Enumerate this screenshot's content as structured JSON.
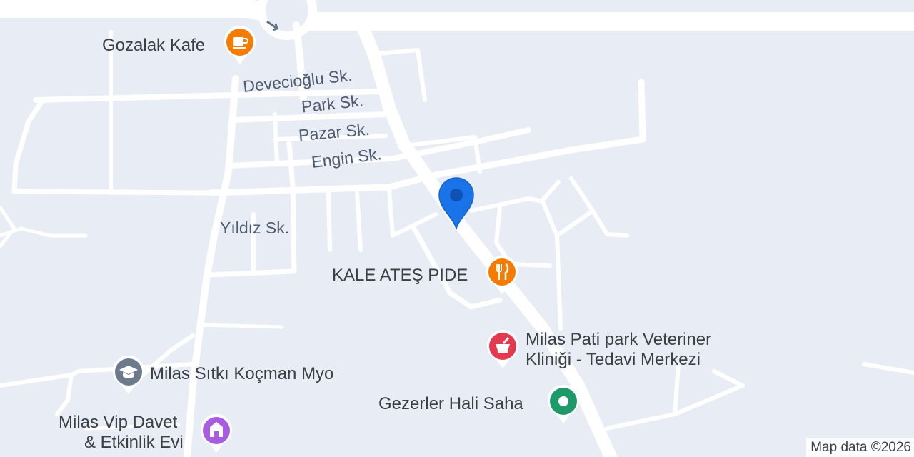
{
  "map": {
    "streets": {
      "devecioglu": "Devecioğlu Sk.",
      "park": "Park Sk.",
      "pazar": "Pazar Sk.",
      "engin": "Engin Sk.",
      "yildiz": "Yıldız Sk."
    },
    "pois": {
      "gozalak": {
        "name": "Gozalak Kafe",
        "icon": "coffee-cup-icon",
        "color": "#f57c00"
      },
      "kale": {
        "name": "KALE ATEŞ PIDE",
        "icon": "fork-knife-icon",
        "color": "#f57c00"
      },
      "vet_line1": "Milas Pati park Veteriner",
      "vet_line2": "Kliniği - Tedavi Merkezi",
      "vet_icon": "mortar-pestle-icon",
      "vet_color": "#e53950",
      "gezerler": {
        "name": "Gezerler Hali Saha",
        "icon": "green-dot-icon",
        "color": "#1e9a6a"
      },
      "myo": {
        "name": "Milas Sıtkı Koçman Myo",
        "icon": "graduation-cap-icon",
        "color": "#6b7b8c"
      },
      "vip_line1": "Milas Vip Davet",
      "vip_line2": "& Etkinlik Evi",
      "vip_icon": "event-hall-icon",
      "vip_color": "#a85ce0"
    },
    "location_marker": {
      "icon": "location-pin-icon",
      "color": "#1a73e8"
    },
    "attribution": "Map data ©2026"
  }
}
